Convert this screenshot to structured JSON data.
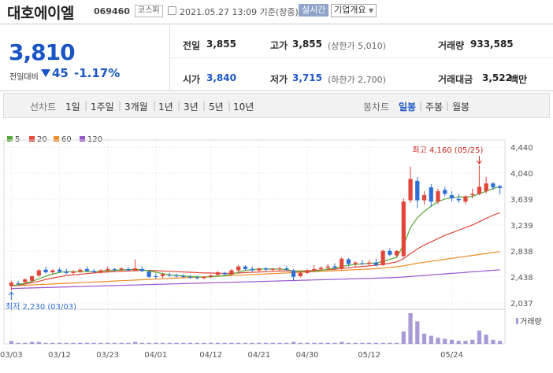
{
  "header": {
    "name": "대호에이엘",
    "code": "069460",
    "market": "코스피",
    "datetime": "2021.05.27 13:09 기준(장중)",
    "realtime_label": "실시간",
    "overview_label": "기업개요"
  },
  "summary": {
    "price": "3,810",
    "prev_label": "전일대비",
    "change": "45",
    "change_pct": "-1.17%",
    "stats": [
      {
        "label": "전일",
        "value": "3,855",
        "sub": "",
        "color": "black"
      },
      {
        "label": "고가",
        "value": "3,855",
        "sub": "(상한가 5,010)",
        "color": "black"
      },
      {
        "label": "거래량",
        "value": "933,585",
        "sub": "",
        "color": "black"
      },
      {
        "label": "시가",
        "value": "3,840",
        "sub": "",
        "color": "blue"
      },
      {
        "label": "저가",
        "value": "3,715",
        "sub": "(하한가 2,700)",
        "color": "blue"
      },
      {
        "label": "거래대금",
        "value": "3,522",
        "sub": "백만",
        "color": "black"
      }
    ]
  },
  "tabs": {
    "line_label": "선차트",
    "periods": [
      "1일",
      "1주일",
      "3개월",
      "1년",
      "3년",
      "5년",
      "10년"
    ],
    "candle_label": "봉차트",
    "candle_periods": [
      "일봉",
      "주봉",
      "월봉"
    ],
    "candle_active": "일봉"
  },
  "legend": [
    {
      "label": "5",
      "color": "#55aa33"
    },
    {
      "label": "20",
      "color": "#e0463a"
    },
    {
      "label": "60",
      "color": "#f08a24"
    },
    {
      "label": "120",
      "color": "#9955cc"
    }
  ],
  "chart_data": {
    "type": "candlestick",
    "y_ticks": [
      "4,440",
      "4,040",
      "3,639",
      "3,239",
      "2,838",
      "2,438",
      "2,037"
    ],
    "ylim": [
      2037,
      4440
    ],
    "x_labels": [
      "03/03",
      "03/12",
      "03/23",
      "04/01",
      "04/12",
      "04/21",
      "04/30",
      "05/12",
      "05/24"
    ],
    "high_annotation": "최고 4,160 (05/25)",
    "low_annotation": "최저 2,230 (03/03)",
    "volume_label": "거래량",
    "colors": {
      "up": "#e0463a",
      "down": "#2e6fd6"
    },
    "candles": [
      {
        "o": 2300,
        "h": 2380,
        "l": 2230,
        "c": 2350
      },
      {
        "o": 2340,
        "h": 2380,
        "l": 2310,
        "c": 2330
      },
      {
        "o": 2360,
        "h": 2420,
        "l": 2330,
        "c": 2400
      },
      {
        "o": 2380,
        "h": 2460,
        "l": 2350,
        "c": 2450
      },
      {
        "o": 2460,
        "h": 2560,
        "l": 2440,
        "c": 2540
      },
      {
        "o": 2550,
        "h": 2600,
        "l": 2490,
        "c": 2510
      },
      {
        "o": 2510,
        "h": 2560,
        "l": 2480,
        "c": 2540
      },
      {
        "o": 2550,
        "h": 2580,
        "l": 2500,
        "c": 2520
      },
      {
        "o": 2520,
        "h": 2560,
        "l": 2480,
        "c": 2500
      },
      {
        "o": 2500,
        "h": 2540,
        "l": 2470,
        "c": 2520
      },
      {
        "o": 2520,
        "h": 2570,
        "l": 2500,
        "c": 2550
      },
      {
        "o": 2560,
        "h": 2600,
        "l": 2520,
        "c": 2530
      },
      {
        "o": 2530,
        "h": 2560,
        "l": 2500,
        "c": 2510
      },
      {
        "o": 2510,
        "h": 2560,
        "l": 2490,
        "c": 2540
      },
      {
        "o": 2540,
        "h": 2600,
        "l": 2520,
        "c": 2560
      },
      {
        "o": 2560,
        "h": 2580,
        "l": 2530,
        "c": 2550
      },
      {
        "o": 2550,
        "h": 2590,
        "l": 2520,
        "c": 2570
      },
      {
        "o": 2560,
        "h": 2590,
        "l": 2530,
        "c": 2540
      },
      {
        "o": 2540,
        "h": 2710,
        "l": 2530,
        "c": 2570
      },
      {
        "o": 2560,
        "h": 2600,
        "l": 2510,
        "c": 2530
      },
      {
        "o": 2520,
        "h": 2540,
        "l": 2420,
        "c": 2440
      },
      {
        "o": 2450,
        "h": 2490,
        "l": 2410,
        "c": 2440
      },
      {
        "o": 2450,
        "h": 2500,
        "l": 2420,
        "c": 2480
      },
      {
        "o": 2470,
        "h": 2500,
        "l": 2440,
        "c": 2460
      },
      {
        "o": 2460,
        "h": 2490,
        "l": 2430,
        "c": 2450
      },
      {
        "o": 2450,
        "h": 2480,
        "l": 2420,
        "c": 2440
      },
      {
        "o": 2440,
        "h": 2470,
        "l": 2410,
        "c": 2430
      },
      {
        "o": 2430,
        "h": 2460,
        "l": 2400,
        "c": 2420
      },
      {
        "o": 2420,
        "h": 2450,
        "l": 2400,
        "c": 2440
      },
      {
        "o": 2440,
        "h": 2480,
        "l": 2420,
        "c": 2460
      },
      {
        "o": 2470,
        "h": 2530,
        "l": 2450,
        "c": 2510
      },
      {
        "o": 2500,
        "h": 2520,
        "l": 2460,
        "c": 2480
      },
      {
        "o": 2480,
        "h": 2560,
        "l": 2460,
        "c": 2540
      },
      {
        "o": 2540,
        "h": 2620,
        "l": 2510,
        "c": 2600
      },
      {
        "o": 2600,
        "h": 2620,
        "l": 2540,
        "c": 2560
      },
      {
        "o": 2560,
        "h": 2600,
        "l": 2520,
        "c": 2540
      },
      {
        "o": 2540,
        "h": 2580,
        "l": 2520,
        "c": 2570
      },
      {
        "o": 2570,
        "h": 2590,
        "l": 2530,
        "c": 2550
      },
      {
        "o": 2550,
        "h": 2580,
        "l": 2520,
        "c": 2560
      },
      {
        "o": 2560,
        "h": 2600,
        "l": 2530,
        "c": 2570
      },
      {
        "o": 2570,
        "h": 2610,
        "l": 2540,
        "c": 2550
      },
      {
        "o": 2540,
        "h": 2560,
        "l": 2380,
        "c": 2440
      },
      {
        "o": 2450,
        "h": 2520,
        "l": 2430,
        "c": 2500
      },
      {
        "o": 2500,
        "h": 2560,
        "l": 2480,
        "c": 2540
      },
      {
        "o": 2540,
        "h": 2620,
        "l": 2520,
        "c": 2560
      },
      {
        "o": 2560,
        "h": 2600,
        "l": 2540,
        "c": 2580
      },
      {
        "o": 2580,
        "h": 2640,
        "l": 2560,
        "c": 2600
      },
      {
        "o": 2600,
        "h": 2650,
        "l": 2560,
        "c": 2580
      },
      {
        "o": 2560,
        "h": 2740,
        "l": 2540,
        "c": 2720
      },
      {
        "o": 2710,
        "h": 2730,
        "l": 2600,
        "c": 2640
      },
      {
        "o": 2640,
        "h": 2680,
        "l": 2600,
        "c": 2660
      },
      {
        "o": 2650,
        "h": 2700,
        "l": 2620,
        "c": 2640
      },
      {
        "o": 2640,
        "h": 2700,
        "l": 2610,
        "c": 2660
      },
      {
        "o": 2660,
        "h": 2720,
        "l": 2600,
        "c": 2620
      },
      {
        "o": 2620,
        "h": 2860,
        "l": 2610,
        "c": 2840
      },
      {
        "o": 2840,
        "h": 2880,
        "l": 2760,
        "c": 2780
      },
      {
        "o": 2770,
        "h": 2850,
        "l": 2740,
        "c": 2840
      },
      {
        "o": 2760,
        "h": 3650,
        "l": 2740,
        "c": 3600
      },
      {
        "o": 3620,
        "h": 4140,
        "l": 3580,
        "c": 3950
      },
      {
        "o": 3920,
        "h": 3980,
        "l": 3500,
        "c": 3620
      },
      {
        "o": 3620,
        "h": 3760,
        "l": 3550,
        "c": 3700
      },
      {
        "o": 3820,
        "h": 3870,
        "l": 3520,
        "c": 3600
      },
      {
        "o": 3600,
        "h": 3800,
        "l": 3560,
        "c": 3760
      },
      {
        "o": 3780,
        "h": 3830,
        "l": 3680,
        "c": 3720
      },
      {
        "o": 3700,
        "h": 3760,
        "l": 3600,
        "c": 3650
      },
      {
        "o": 3640,
        "h": 3720,
        "l": 3580,
        "c": 3620
      },
      {
        "o": 3600,
        "h": 3700,
        "l": 3560,
        "c": 3680
      },
      {
        "o": 3700,
        "h": 3800,
        "l": 3650,
        "c": 3720
      },
      {
        "o": 3720,
        "h": 4160,
        "l": 3700,
        "c": 3830
      },
      {
        "o": 3760,
        "h": 3980,
        "l": 3730,
        "c": 3880
      },
      {
        "o": 3880,
        "h": 3900,
        "l": 3780,
        "c": 3820
      },
      {
        "o": 3840,
        "h": 3855,
        "l": 3715,
        "c": 3810
      }
    ],
    "volume": [
      3,
      1,
      1,
      2,
      2,
      1,
      1,
      1,
      1,
      1,
      1,
      1,
      1,
      1,
      1,
      1,
      1,
      1,
      2,
      1,
      1,
      1,
      1,
      1,
      1,
      1,
      1,
      1,
      1,
      1,
      1,
      1,
      1,
      1,
      1,
      1,
      1,
      1,
      1,
      1,
      1,
      2,
      1,
      1,
      1,
      1,
      1,
      1,
      2,
      1,
      1,
      1,
      1,
      1,
      1,
      1,
      1,
      12,
      30,
      22,
      10,
      8,
      6,
      5,
      4,
      3,
      3,
      4,
      13,
      9,
      4,
      3
    ],
    "ma": {
      "5": [
        2300,
        2320,
        2340,
        2370,
        2410,
        2450,
        2480,
        2510,
        2520,
        2520,
        2520,
        2520,
        2520,
        2530,
        2535,
        2540,
        2545,
        2550,
        2555,
        2550,
        2530,
        2510,
        2490,
        2470,
        2460,
        2455,
        2445,
        2440,
        2435,
        2440,
        2450,
        2460,
        2480,
        2510,
        2540,
        2550,
        2560,
        2560,
        2560,
        2560,
        2550,
        2530,
        2520,
        2520,
        2520,
        2540,
        2560,
        2570,
        2600,
        2620,
        2630,
        2640,
        2650,
        2650,
        2680,
        2710,
        2740,
        2930,
        3200,
        3350,
        3450,
        3530,
        3600,
        3640,
        3660,
        3670,
        3670,
        3680,
        3720,
        3760,
        3800,
        3830
      ],
      "20": [
        2300,
        2310,
        2330,
        2350,
        2370,
        2400,
        2420,
        2440,
        2460,
        2470,
        2480,
        2490,
        2500,
        2510,
        2515,
        2520,
        2525,
        2530,
        2535,
        2540,
        2540,
        2535,
        2530,
        2525,
        2520,
        2515,
        2510,
        2505,
        2500,
        2500,
        2495,
        2495,
        2495,
        2500,
        2505,
        2510,
        2515,
        2520,
        2525,
        2530,
        2530,
        2530,
        2530,
        2535,
        2540,
        2545,
        2550,
        2555,
        2570,
        2580,
        2590,
        2600,
        2610,
        2620,
        2635,
        2650,
        2670,
        2720,
        2800,
        2870,
        2930,
        2980,
        3030,
        3080,
        3120,
        3160,
        3200,
        3240,
        3290,
        3340,
        3390,
        3430
      ],
      "60": [
        2300,
        2305,
        2310,
        2315,
        2320,
        2325,
        2330,
        2335,
        2340,
        2345,
        2350,
        2355,
        2360,
        2365,
        2370,
        2375,
        2380,
        2385,
        2390,
        2395,
        2400,
        2405,
        2410,
        2415,
        2420,
        2425,
        2430,
        2435,
        2440,
        2445,
        2450,
        2455,
        2460,
        2465,
        2470,
        2475,
        2480,
        2485,
        2490,
        2495,
        2500,
        2505,
        2510,
        2515,
        2520,
        2525,
        2530,
        2535,
        2540,
        2545,
        2550,
        2555,
        2560,
        2565,
        2575,
        2585,
        2595,
        2610,
        2630,
        2650,
        2665,
        2680,
        2695,
        2710,
        2725,
        2740,
        2755,
        2770,
        2785,
        2800,
        2815,
        2830
      ],
      "120": [
        2260,
        2263,
        2266,
        2269,
        2272,
        2275,
        2278,
        2281,
        2284,
        2287,
        2290,
        2293,
        2296,
        2299,
        2302,
        2305,
        2308,
        2311,
        2314,
        2317,
        2320,
        2323,
        2326,
        2329,
        2332,
        2335,
        2338,
        2341,
        2344,
        2347,
        2350,
        2353,
        2356,
        2359,
        2362,
        2365,
        2368,
        2371,
        2374,
        2377,
        2380,
        2383,
        2386,
        2389,
        2392,
        2395,
        2398,
        2401,
        2404,
        2407,
        2410,
        2413,
        2416,
        2419,
        2423,
        2427,
        2431,
        2437,
        2445,
        2453,
        2461,
        2469,
        2477,
        2485,
        2493,
        2501,
        2509,
        2517,
        2525,
        2533,
        2541,
        2549
      ]
    }
  }
}
